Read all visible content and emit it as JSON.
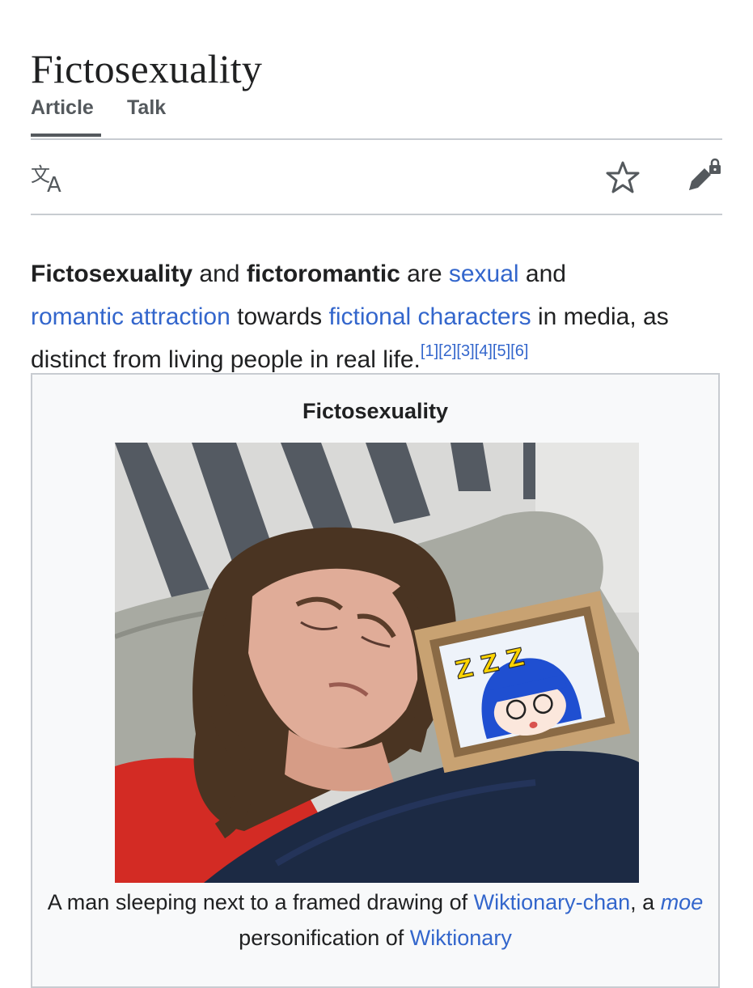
{
  "page": {
    "title": "Fictosexuality"
  },
  "tabs": [
    {
      "label": "Article",
      "active": true
    },
    {
      "label": "Talk",
      "active": false
    }
  ],
  "toolbar": {
    "icons": [
      "translate-icon",
      "star-icon",
      "edit-lock-icon"
    ]
  },
  "lead": {
    "term1": "Fictosexuality",
    "t_and1": " and ",
    "term2": "fictoromantic",
    "t_are": " are ",
    "link_sexual": "sexual",
    "t_and2": " and ",
    "link_romantic": "romantic attraction",
    "t_towards": " towards ",
    "link_fictional": "fictional characters",
    "t_rest": " in media, as distinct from living people in real life.",
    "refs": [
      "[1]",
      "[2]",
      "[3]",
      "[4]",
      "[5]",
      "[6]"
    ]
  },
  "infobox": {
    "title": "Fictosexuality",
    "caption": {
      "t1": "A man sleeping next to a framed drawing of ",
      "link1": "Wiktionary-chan",
      "t2": ", a ",
      "link2": "moe",
      "t3": " personification of ",
      "link3": "Wiktionary"
    },
    "drawing_text": "Z Z Z"
  },
  "colors": {
    "link": "#3366cc",
    "text": "#202122",
    "border": "#c8ccd1",
    "infobox_bg": "#f8f9fa"
  }
}
